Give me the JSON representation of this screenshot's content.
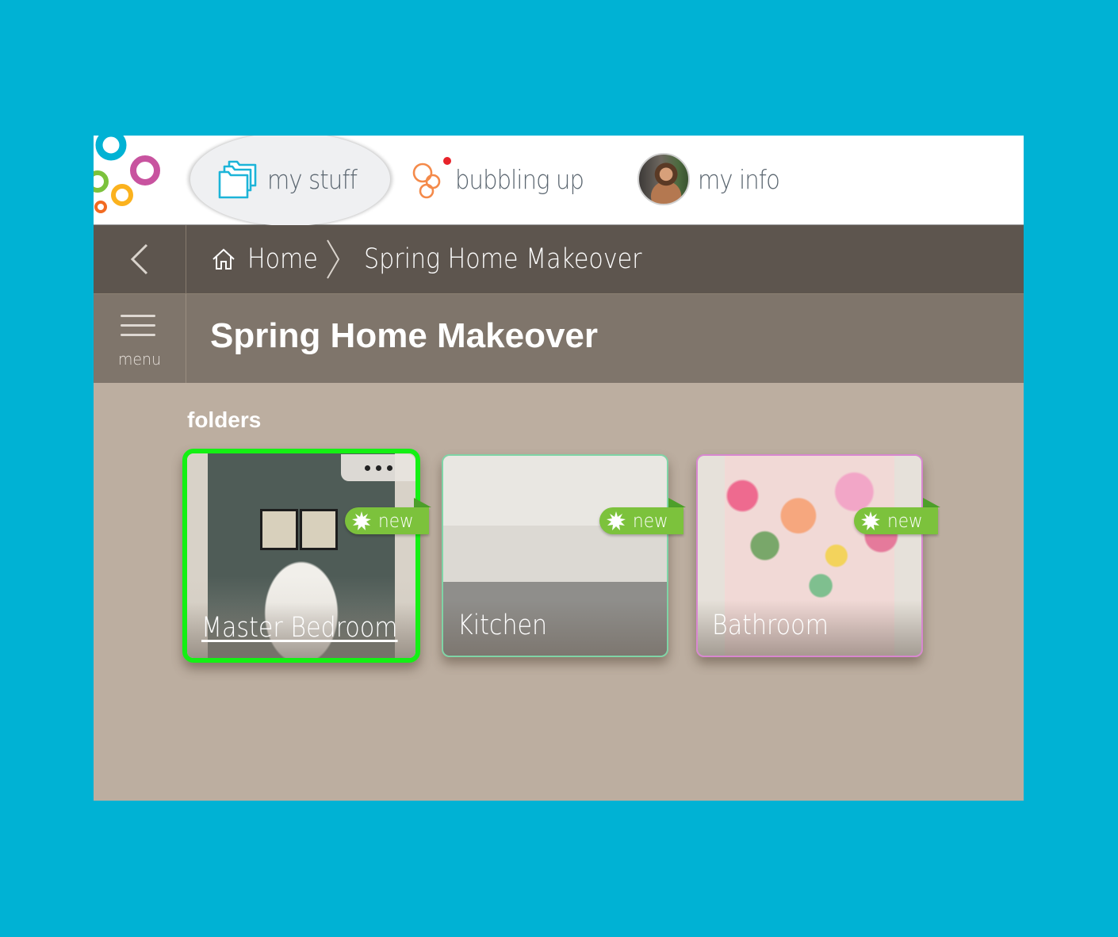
{
  "nav": {
    "logo_icon": "bubbles-logo-icon",
    "tabs": [
      {
        "label": "my stuff",
        "icon": "folders-icon",
        "active": true
      },
      {
        "label": "bubbling up",
        "icon": "bubbles-icon",
        "notification_dot": true
      },
      {
        "label": "my info",
        "icon": "avatar"
      }
    ]
  },
  "breadcrumb": {
    "back_icon": "chevron-left-icon",
    "items": [
      {
        "label": "Home",
        "icon": "home-icon"
      },
      {
        "label": "Spring Home Makeover"
      }
    ],
    "separator_icon": "chevron-right-icon"
  },
  "title_bar": {
    "menu_label": "menu",
    "title": "Spring Home Makeover"
  },
  "folders": {
    "section_label": "folders",
    "items": [
      {
        "name": "Master Bedroom",
        "badge": "new",
        "selected": true,
        "accent": "#14f014",
        "has_more_menu": true
      },
      {
        "name": "Kitchen",
        "badge": "new",
        "accent": "#7fd4a6"
      },
      {
        "name": "Bathroom",
        "badge": "new",
        "accent": "#d887d0"
      }
    ]
  },
  "colors": {
    "page_background": "#00b2d4",
    "content_background": "#bcaea0",
    "breadcrumb_bar": "#5d554e",
    "title_bar": "#7f756b",
    "badge_green": "#7cc23c"
  }
}
